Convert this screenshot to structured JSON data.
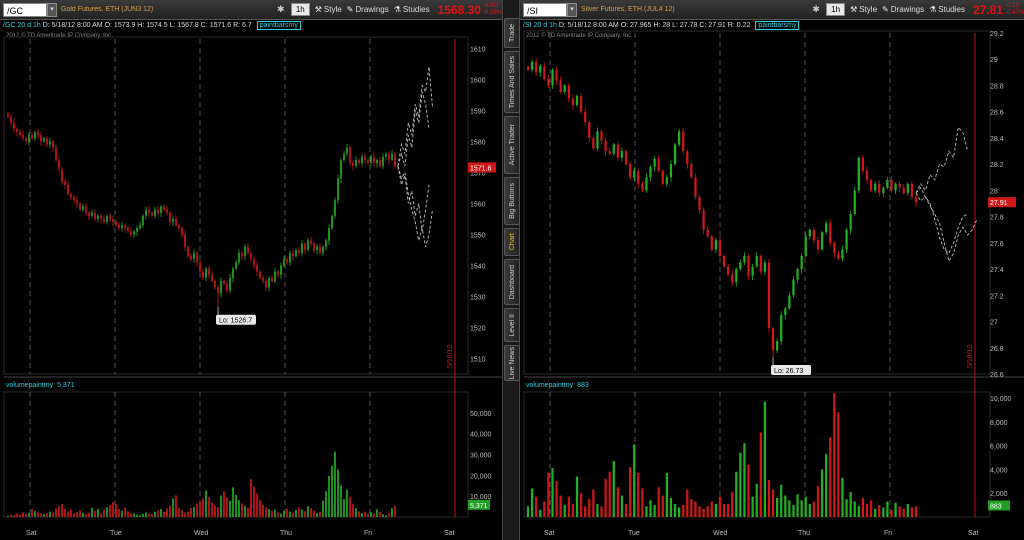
{
  "left": {
    "symbol": "/GC",
    "description": "Gold Futures, ETH (JUN3 12)",
    "timeframe": "1h",
    "last_price": "1568.30",
    "change": [
      "-4.60",
      "-0.29%"
    ],
    "buttons": {
      "style": "Style",
      "drawings": "Drawings",
      "studies": "Studies"
    },
    "status": {
      "sym": "/GC 20 d 1h",
      "d": "D: 5/18/12 8:00 AM",
      "o": "O: 1573.9",
      "h": "H: 1574.5",
      "l": "L: 1567.8",
      "c": "C: 1571.6",
      "r": "R: 6.7",
      "study": "paintbarsmy"
    },
    "copyright": "2012 © TD Ameritrade IP Company, Inc.",
    "price_marker": "1571.6",
    "low_label": "Lo: 1526.7",
    "date_marker": "5/18/12",
    "volume_label": "volumepaintmy",
    "volume_value": "5,371",
    "volume_marker": "5,371",
    "price_axis": [
      "1610",
      "1600",
      "1590",
      "1580",
      "1570",
      "1560",
      "1550",
      "1540",
      "1530",
      "1520",
      "1510"
    ],
    "volume_axis": [
      "50,000",
      "40,000",
      "30,000",
      "20,000",
      "10,000"
    ],
    "day_labels": [
      "Sat",
      "Tue",
      "Wed",
      "Thu",
      "Fri",
      "Sat"
    ]
  },
  "right": {
    "symbol": "/SI",
    "description": "Silver Futures, ETH (JUL4 12)",
    "timeframe": "1h",
    "last_price": "27.81",
    "change": [
      "-0.13",
      "-0.47%"
    ],
    "buttons": {
      "style": "Style",
      "drawings": "Drawings",
      "studies": "Studies"
    },
    "status": {
      "sym": "/SI 20 d 1h",
      "d": "D: 5/18/12 8:00 AM",
      "o": "O: 27.965",
      "h": "H: 28",
      "l": "L: 27.78",
      "c": "C: 27.91",
      "r": "R: 0.22",
      "study": "paintbarsmy"
    },
    "copyright": "2012 © TD Ameritrade IP Company, Inc.",
    "price_marker": "27.91",
    "low_label": "Lo: 26.73",
    "date_marker": "5/18/12",
    "volume_label": "volumepaintmy",
    "volume_value": "883",
    "volume_marker": "883",
    "price_axis": [
      "29.2",
      "29",
      "28.8",
      "28.6",
      "28.4",
      "28.2",
      "28",
      "27.8",
      "27.6",
      "27.4",
      "27.2",
      "27",
      "26.8",
      "26.6"
    ],
    "volume_axis": [
      "10,000",
      "8,000",
      "6,000",
      "4,000",
      "2,000"
    ],
    "day_labels": [
      "Sat",
      "Tue",
      "Wed",
      "Thu",
      "Fri",
      "Sat"
    ]
  },
  "sidebar_tabs": [
    {
      "label": "Trade",
      "active": false
    },
    {
      "label": "Times And Sales",
      "active": false
    },
    {
      "label": "Active Trader",
      "active": false
    },
    {
      "label": "Big Buttons",
      "active": false
    },
    {
      "label": "Chart",
      "active": true
    },
    {
      "label": "Dashboard",
      "active": false
    },
    {
      "label": "Level II",
      "active": false
    },
    {
      "label": "Live News",
      "active": false
    }
  ],
  "colors": {
    "up": "#22b022",
    "down": "#d01818",
    "cyan": "#2bd1e0",
    "projection": "#bbbbbb",
    "accent_red": "#e21212"
  },
  "chart_data": [
    {
      "type": "candlestick",
      "title": "/GC 20 d 1h",
      "ylim": [
        1505,
        1613
      ],
      "days": [
        "Sat",
        "Tue",
        "Wed",
        "Thu",
        "Fri",
        "Sat"
      ],
      "closes": [
        1588,
        1586,
        1584,
        1583,
        1582,
        1581,
        1580,
        1582,
        1581,
        1583,
        1582,
        1580,
        1581,
        1579,
        1580,
        1578,
        1574,
        1571,
        1567,
        1566,
        1563,
        1562,
        1561,
        1560,
        1558,
        1559,
        1557,
        1556,
        1557,
        1555,
        1556,
        1555,
        1554,
        1556,
        1555,
        1554,
        1553,
        1552,
        1553,
        1552,
        1551,
        1550,
        1551,
        1552,
        1553,
        1556,
        1558,
        1557,
        1556,
        1558,
        1557,
        1559,
        1558,
        1557,
        1554,
        1555,
        1553,
        1552,
        1550,
        1546,
        1543,
        1542,
        1544,
        1541,
        1538,
        1536,
        1539,
        1537,
        1535,
        1533,
        1531,
        1535,
        1534,
        1532,
        1536,
        1539,
        1541,
        1544,
        1543,
        1546,
        1544,
        1542,
        1540,
        1538,
        1536,
        1535,
        1533,
        1536,
        1535,
        1538,
        1537,
        1540,
        1542,
        1541,
        1544,
        1543,
        1545,
        1544,
        1547,
        1545,
        1548,
        1547,
        1545,
        1546,
        1544,
        1546,
        1548,
        1552,
        1556,
        1561,
        1568,
        1574,
        1576,
        1578,
        1573,
        1572,
        1574,
        1573,
        1575,
        1574,
        1573,
        1575,
        1573,
        1574,
        1572,
        1575,
        1576,
        1574,
        1576,
        1572,
        1571.6
      ],
      "projections": [
        [
          [
            1572,
            1579,
            1576,
            1586,
            1582,
            1592,
            1588,
            1598,
            1596,
            1604,
            1591
          ],
          [
            1572,
            1576,
            1572,
            1582,
            1578,
            1590,
            1586,
            1596,
            1592,
            1584
          ]
        ],
        [
          [
            1572,
            1566,
            1569,
            1560,
            1564,
            1556,
            1560,
            1551,
            1558,
            1566
          ],
          [
            1572,
            1568,
            1570,
            1563,
            1558,
            1554,
            1548,
            1552,
            1546,
            1550,
            1558
          ]
        ]
      ],
      "low": 1526.7,
      "volume": [
        600,
        1200,
        900,
        1600,
        1100,
        2200,
        1500,
        1800,
        3800,
        2800,
        2400,
        1700,
        1300,
        1900,
        2600,
        2100,
        4100,
        5200,
        6100,
        3900,
        2700,
        3400,
        1600,
        2300,
        3100,
        2000,
        1500,
        2100,
        4300,
        2900,
        3900,
        1700,
        3600,
        4600,
        5700,
        7200,
        6200,
        3800,
        3100,
        4500,
        2800,
        1900,
        1600,
        1200,
        800,
        1500,
        2200,
        1700,
        1400,
        2600,
        3200,
        3800,
        2400,
        4100,
        5600,
        8900,
        10400,
        4200,
        3300,
        1800,
        2500,
        4300,
        4800,
        6500,
        7300,
        8900,
        12800,
        9600,
        7100,
        5600,
        4700,
        10200,
        12300,
        9400,
        7800,
        14200,
        10600,
        8100,
        6600,
        5300,
        4400,
        18100,
        14600,
        11300,
        8200,
        5900,
        4600,
        3700,
        2800,
        3400,
        2200,
        1700,
        2900,
        3800,
        2600,
        2100,
        3400,
        4700,
        3600,
        2800,
        5200,
        4300,
        3100,
        1800,
        2500,
        7800,
        12400,
        19700,
        24600,
        31400,
        22800,
        15200,
        8600,
        13100,
        9700,
        6400,
        4200,
        2800,
        1900,
        2600,
        1500,
        2300,
        1700,
        3600,
        2400,
        1300,
        900,
        1800,
        4200,
        5371
      ]
    },
    {
      "type": "candlestick",
      "title": "/SI 20 d 1h",
      "ylim": [
        26.6,
        29.2
      ],
      "days": [
        "Sat",
        "Tue",
        "Wed",
        "Thu",
        "Fri",
        "Sat"
      ],
      "closes": [
        28.92,
        28.98,
        28.9,
        28.95,
        28.85,
        28.8,
        28.92,
        28.84,
        28.75,
        28.8,
        28.7,
        28.65,
        28.72,
        28.6,
        28.52,
        28.4,
        28.32,
        28.45,
        28.38,
        28.3,
        28.28,
        28.35,
        28.25,
        28.3,
        28.2,
        28.1,
        28.15,
        28.05,
        28.0,
        28.1,
        28.18,
        28.24,
        28.15,
        28.05,
        28.1,
        28.2,
        28.35,
        28.45,
        28.3,
        28.2,
        28.1,
        27.95,
        27.85,
        27.7,
        27.65,
        27.55,
        27.62,
        27.5,
        27.42,
        27.36,
        27.3,
        27.4,
        27.45,
        27.5,
        27.35,
        27.42,
        27.5,
        27.38,
        27.45,
        26.95,
        26.78,
        26.85,
        27.05,
        27.1,
        27.2,
        27.32,
        27.4,
        27.5,
        27.65,
        27.7,
        27.62,
        27.55,
        27.68,
        27.75,
        27.6,
        27.52,
        27.48,
        27.55,
        27.7,
        27.82,
        28.0,
        28.25,
        28.15,
        28.08,
        28.0,
        28.05,
        27.98,
        28.02,
        28.08,
        28.0,
        28.05,
        28.02,
        27.98,
        28.05,
        27.95,
        27.91
      ],
      "projections": [
        [
          [
            27.98,
            28.05,
            28.0,
            28.12,
            28.08,
            28.2,
            28.18,
            28.3,
            28.25,
            28.48,
            28.44,
            28.3
          ],
          [
            27.98,
            27.92,
            27.95,
            27.88,
            27.82,
            27.75,
            27.6,
            27.46,
            27.52,
            27.66,
            27.72,
            27.66,
            27.7,
            27.78
          ]
        ],
        [
          [
            27.98,
            28.02,
            27.95,
            27.9,
            27.78,
            27.64,
            27.55,
            27.52,
            27.6,
            27.72,
            27.8,
            27.82
          ]
        ]
      ],
      "low": 26.73,
      "volume": [
        900,
        2400,
        1700,
        600,
        1300,
        3700,
        4100,
        3000,
        1800,
        1000,
        1700,
        1100,
        3400,
        2000,
        900,
        1500,
        2300,
        1100,
        900,
        3200,
        3800,
        4700,
        2500,
        1800,
        1100,
        4200,
        6100,
        3700,
        2400,
        900,
        1400,
        1000,
        2500,
        1800,
        3700,
        1600,
        1100,
        800,
        1000,
        2300,
        1500,
        1300,
        900,
        700,
        900,
        1300,
        1100,
        1700,
        1100,
        1100,
        2100,
        3800,
        5400,
        6200,
        4400,
        1700,
        2800,
        7100,
        9700,
        3100,
        2300,
        1600,
        2700,
        1800,
        1400,
        1000,
        1900,
        1400,
        1700,
        1100,
        1300,
        2600,
        4000,
        5300,
        6700,
        10400,
        8800,
        3300,
        1500,
        2100,
        1300,
        900,
        1600,
        1100,
        1400,
        700,
        1000,
        800,
        1300,
        600,
        1200,
        900,
        700,
        1100,
        800,
        883
      ]
    }
  ]
}
